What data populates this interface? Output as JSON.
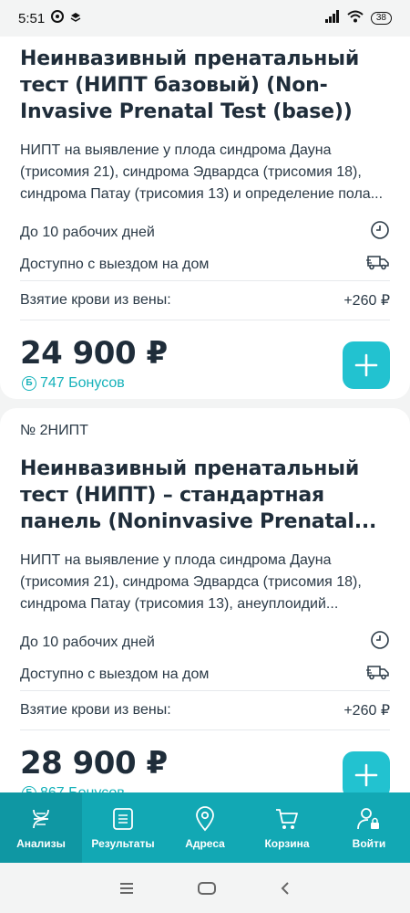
{
  "status": {
    "time": "5:51",
    "battery": "38"
  },
  "cards": [
    {
      "code": "",
      "title": "Неинвазивный пренатальный тест (НИПТ базовый) (Non-Invasive Prenatal Test (base))",
      "description": "НИПТ на выявление у плода синдрома Дауна (трисомия 21), синдрома Эдвардса (трисомия 18), синдрома Патау (трисомия 13) и определение пола...",
      "duration": "До 10 рабочих дней",
      "home_visit": "Доступно с выездом на дом",
      "blood_draw_label": "Взятие крови из вены:",
      "blood_draw_price": "+260 ₽",
      "price": "24 900 ₽",
      "bonus": "747 Бонусов"
    },
    {
      "code": "№ 2НИПТ",
      "title": "Неинвазивный пренатальный тест (НИПТ) – стандартная панель (Noninvasive Prenatal...",
      "description": "НИПТ на выявление у плода синдрома Дауна (трисомия 21), синдрома Эдвардса (трисомия 18), синдрома Патау (трисомия 13), анеуплоидий...",
      "duration": "До 10 рабочих дней",
      "home_visit": "Доступно с выездом на дом",
      "blood_draw_label": "Взятие крови из вены:",
      "blood_draw_price": "+260 ₽",
      "price": "28 900 ₽",
      "bonus": "867 Бонусов"
    }
  ],
  "bonus_symbol": "Б",
  "tabs": [
    {
      "label": "Анализы",
      "icon": "dna-icon",
      "active": true
    },
    {
      "label": "Результаты",
      "icon": "list-icon",
      "active": false
    },
    {
      "label": "Адреса",
      "icon": "location-pin-icon",
      "active": false
    },
    {
      "label": "Корзина",
      "icon": "cart-icon",
      "active": false
    },
    {
      "label": "Войти",
      "icon": "user-lock-icon",
      "active": false
    }
  ],
  "colors": {
    "accent": "#22c2d0",
    "tabbar": "#12a8b4",
    "bonus": "#16b2ba",
    "text": "#1f2d3a"
  }
}
